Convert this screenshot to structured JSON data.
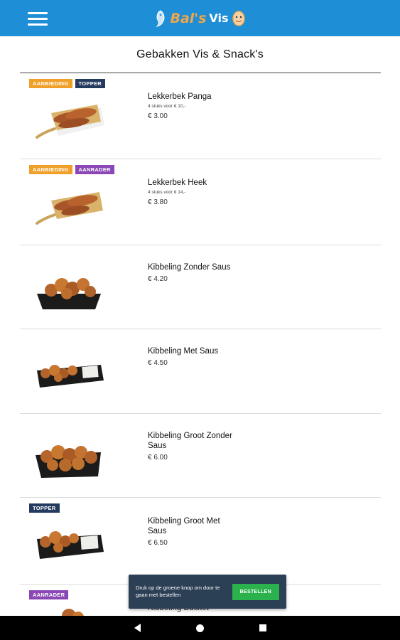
{
  "header": {
    "logo_text_1": "Bal's",
    "logo_text_2": "Vis",
    "brand_colors": {
      "bar": "#1e8fd6",
      "logo_accent": "#f0a64a"
    }
  },
  "page": {
    "title": "Gebakken Vis & Snack's"
  },
  "products": [
    {
      "badges": [
        {
          "label": "AANBIEDING",
          "color": "orange"
        },
        {
          "label": "TOPPER",
          "color": "navy"
        }
      ],
      "name": "Lekkerbek Panga",
      "offer": "4 stuks voor € 10,-",
      "price": "€ 3.00",
      "image": "lekkerbek-board-image"
    },
    {
      "badges": [
        {
          "label": "AANBIEDING",
          "color": "orange"
        },
        {
          "label": "AANRADER",
          "color": "purple"
        }
      ],
      "name": "Lekkerbek Heek",
      "offer": "4 stuks voor € 14,-",
      "price": "€ 3.80",
      "image": "lekkerbek-board-image"
    },
    {
      "badges": [],
      "name": "Kibbeling Zonder Saus",
      "offer": "",
      "price": "€ 4.20",
      "image": "kibbeling-tray-image"
    },
    {
      "badges": [],
      "name": "Kibbeling Met Saus",
      "offer": "",
      "price": "€ 4.50",
      "image": "kibbeling-sauce-tray-image"
    },
    {
      "badges": [],
      "name": "Kibbeling Groot Zonder Saus",
      "offer": "",
      "price": "€ 6.00",
      "image": "kibbeling-large-tray-image"
    },
    {
      "badges": [
        {
          "label": "TOPPER",
          "color": "navy"
        }
      ],
      "name": "Kibbeling Groot Met Saus",
      "offer": "",
      "price": "€ 6.50",
      "image": "kibbeling-sauce-tray-image"
    },
    {
      "badges": [
        {
          "label": "AANRADER",
          "color": "purple"
        }
      ],
      "name": "Kibbeling Bucket",
      "offer": "",
      "price": "",
      "image": "kibbeling-bucket-image"
    }
  ],
  "toast": {
    "message": "Druk op de groene knop om door te gaan met bestellen",
    "button_label": "BESTELLEN"
  },
  "system_nav": {
    "icons": [
      "back-icon",
      "home-icon",
      "recents-icon"
    ]
  }
}
